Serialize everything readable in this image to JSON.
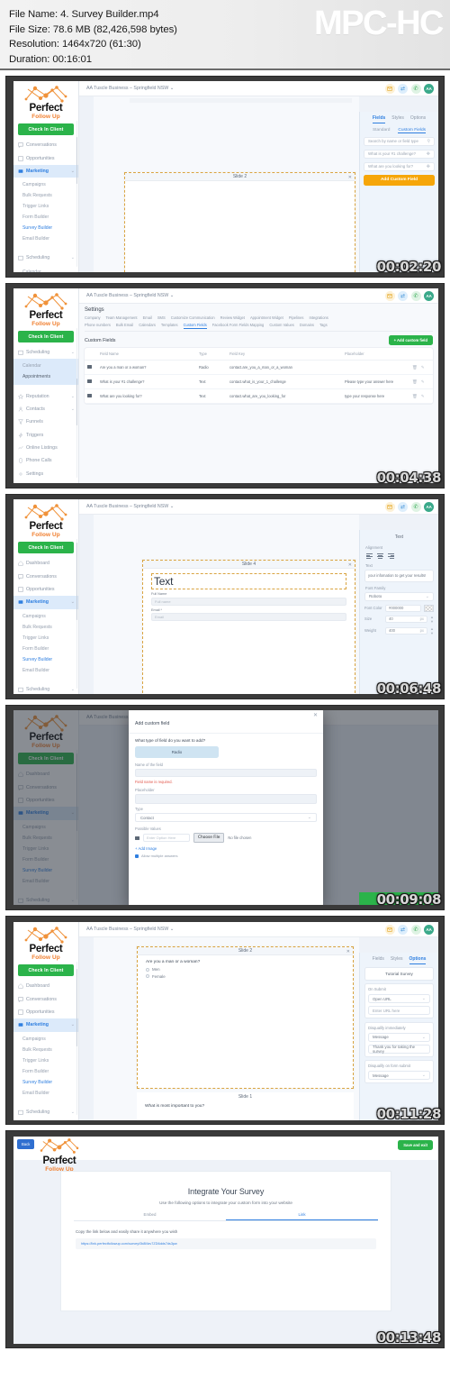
{
  "player": {
    "app_name": "MPC-HC",
    "file_name_line": "File Name: 4. Survey Builder.mp4",
    "file_size_line": "File Size: 78.6 MB (82,426,598 bytes)",
    "resolution_line": "Resolution: 1464x720 (61:30)",
    "duration_line": "Duration: 00:16:01"
  },
  "brand": {
    "name_top": "Perfect",
    "name_bottom": "Follow Up",
    "check_in_button": "Check In Client",
    "logo_icon": "network-nodes-logo-icon"
  },
  "topbar": {
    "location": "AA Tuscle  Business – Springfield NSW",
    "chevron": "⌄",
    "icons": [
      {
        "name": "mail-icon",
        "glyph": "✉"
      },
      {
        "name": "transfer-icon",
        "glyph": "⇄"
      },
      {
        "name": "phone-icon",
        "glyph": "✆"
      },
      {
        "name": "avatar",
        "glyph": "AA"
      }
    ]
  },
  "sidebar": {
    "items_a": [
      {
        "label": "Conversations",
        "icon": "chat-icon",
        "chevron": ""
      },
      {
        "label": "Opportunities",
        "icon": "funnel-icon",
        "chevron": ""
      },
      {
        "label": "Marketing",
        "icon": "megaphone-icon",
        "chevron": "⌄",
        "active": true
      }
    ],
    "marketing_sub": [
      {
        "label": "Campaigns"
      },
      {
        "label": "Bulk Requests"
      },
      {
        "label": "Trigger Links"
      },
      {
        "label": "Form Builder"
      },
      {
        "label": "Survey Builder",
        "selected": true
      },
      {
        "label": "Email Builder"
      }
    ],
    "items_b": [
      {
        "label": "Scheduling",
        "icon": "calendar-icon",
        "chevron": "⌄"
      }
    ],
    "scheduling_sub": [
      {
        "label": "Calendar"
      },
      {
        "label": "Appointments"
      }
    ],
    "items_c": [
      {
        "label": "Dashboard",
        "icon": "home-icon",
        "chevron": ""
      },
      {
        "label": "Reputation",
        "icon": "star-icon",
        "chevron": "⌄"
      },
      {
        "label": "Contacts",
        "icon": "user-icon",
        "chevron": "⌄"
      },
      {
        "label": "Funnels",
        "icon": "funnel2-icon",
        "chevron": ""
      },
      {
        "label": "Triggers",
        "icon": "bolt-icon",
        "chevron": ""
      },
      {
        "label": "Online Listings",
        "icon": "listings-icon",
        "chevron": ""
      },
      {
        "label": "Phone Calls",
        "icon": "phone2-icon",
        "chevron": ""
      },
      {
        "label": "Settings",
        "icon": "gear-icon",
        "chevron": ""
      }
    ]
  },
  "frames": [
    {
      "id": "frame-1",
      "timestamp": "00:02:20",
      "right_panel": {
        "tabs": [
          "Fields",
          "Styles",
          "Options"
        ],
        "active_tab": "Fields",
        "sub_tabs": [
          "Standard",
          "Custom Fields"
        ],
        "active_sub_tab": "Custom Fields",
        "search_placeholder": "Search by name or field type",
        "search_icon": "search-icon",
        "fields": [
          {
            "label": "What is your #1 challenge?",
            "icon": "drag-handle-icon"
          },
          {
            "label": "What are you looking for?",
            "icon": "drag-handle-icon"
          }
        ],
        "add_button": "Add Custom Field"
      },
      "slide_label": "Slide 2",
      "close_icon": "close-icon"
    },
    {
      "id": "frame-2",
      "timestamp": "00:04:38",
      "settings": {
        "title": "Settings",
        "tabs_row1": [
          "Company",
          "Team Management",
          "Email",
          "SMS",
          "Customize Communication",
          "Review Widget",
          "Appointment Widget",
          "Pipelines",
          "Integrations"
        ],
        "tabs_row2": [
          "Phone numbers",
          "Bulk Email",
          "Calendars",
          "Templates",
          "Custom Fields",
          "Facebook Form Fields Mapping",
          "Custom Values",
          "Domains",
          "Tags"
        ],
        "active_tab": "Custom Fields",
        "section_title": "Custom Fields",
        "add_button": "Add custom field",
        "add_icon": "plus-icon",
        "columns": [
          "",
          "Field Name",
          "Type",
          "Field Key",
          "Placeholder",
          "",
          ""
        ],
        "rows": [
          {
            "handle": "drag-handle-icon",
            "field_name": "Are you a man or a woman?",
            "type": "Radio",
            "field_key": "contact.are_you_a_man_or_a_woman",
            "placeholder": "",
            "delete_icon": "trash-icon",
            "edit_icon": "pencil-icon"
          },
          {
            "handle": "drag-handle-icon",
            "field_name": "What is your #1 challenge?",
            "type": "Text",
            "field_key": "contact.what_is_your_1_challenge",
            "placeholder": "Please type your answer here",
            "delete_icon": "trash-icon",
            "edit_icon": "pencil-icon"
          },
          {
            "handle": "drag-handle-icon",
            "field_name": "What are you looking for?",
            "type": "Text",
            "field_key": "contact.what_are_you_looking_for",
            "placeholder": "type your response here",
            "delete_icon": "trash-icon",
            "edit_icon": "pencil-icon"
          }
        ]
      }
    },
    {
      "id": "frame-3",
      "timestamp": "00:06:48",
      "slide_label": "Slide 4",
      "close_icon": "close-icon",
      "heading_text": "Text",
      "fields": [
        {
          "label": "Full Name",
          "placeholder": "Full name"
        },
        {
          "label": "Email *",
          "placeholder": "Email"
        }
      ],
      "props": {
        "title": "Text",
        "alignment_label": "Alignment",
        "alignment_icons": [
          "align-left-icon",
          "align-center-icon",
          "align-right-icon"
        ],
        "text_label": "Text",
        "text_value": "your infomation to get your results!",
        "font_family_label": "Font Family",
        "font_family_value": "Roboto",
        "font_color_label": "Font Color",
        "font_color_value": "#000000",
        "size_label": "Size",
        "size_value": "40",
        "size_unit": "px",
        "weight_label": "Weight",
        "weight_value": "400",
        "weight_unit": "px"
      }
    },
    {
      "id": "frame-4",
      "timestamp": "00:09:08",
      "modal": {
        "title": "Add custom field",
        "close_icon": "close-icon",
        "question": "What type of field do you want to add?",
        "selected_type": "Radio",
        "name_label": "Name of the field",
        "name_value": "",
        "name_error": "Field name is required.",
        "placeholder_label": "Placeholder",
        "placeholder_value": "",
        "type_label": "Type",
        "type_value": "Contact",
        "type_chevron": "⌄",
        "possible_values_label": "Possible Values",
        "value_placeholder": "Enter Option Here",
        "file_button": "Choose File",
        "file_status": "No file chosen",
        "add_image": "+  Add Image",
        "checkbox_label": "Allow multiple answers",
        "handle_icon": "drag-handle-icon"
      }
    },
    {
      "id": "frame-5",
      "timestamp": "00:11:28",
      "slides": [
        {
          "label": "Slide 2",
          "close_icon": "close-icon",
          "question": "Are you a man or a woman?",
          "options": [
            "Men",
            "Female"
          ]
        },
        {
          "label": "Slide 1",
          "question": "What is most important to you?"
        }
      ],
      "right_panel": {
        "tabs": [
          "Fields",
          "Styles",
          "Options"
        ],
        "active_tab": "Options",
        "survey_name": "Tutorial Survey",
        "on_submit_label": "On Submit",
        "on_submit_value": "Open URL",
        "url_placeholder": "Enter URL here",
        "disq_immediate_label": "Disqualify immediately",
        "disq_immediate_value": "Message",
        "disq_message": "Thank you for taking the survey",
        "disq_submit_label": "Disqualify on form submit",
        "disq_submit_value": "Message",
        "chevron": "⌄"
      }
    },
    {
      "id": "frame-6",
      "timestamp": "00:13:48",
      "back_button": "Back",
      "save_exit_button": "Save and exit",
      "integrate": {
        "title": "Integrate Your Survey",
        "subtitle": "Use the following options to integrate your custom form into your website",
        "tabs": [
          "Embed",
          "Link"
        ],
        "active_tab": "Link",
        "copy_text": "Copy the link below and easily share it anywhere you wish",
        "url": "https://link.perfectfollowup.com/survey/0k8Mzv7ZD6dds7ds3pw"
      }
    }
  ],
  "colors": {
    "green": "#2bb34a",
    "orange": "#f6a609",
    "blue": "#2f7fe0",
    "brand_orange": "#f07c2a",
    "error_red": "#e2564a"
  }
}
